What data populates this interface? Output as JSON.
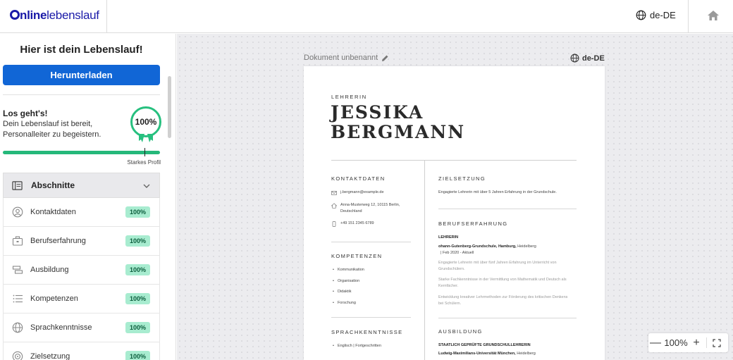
{
  "header": {
    "logo_bold": "nline",
    "logo_rest": "lebenslauf",
    "language": "de-DE",
    "icons": [
      "globe-icon",
      "home-icon"
    ]
  },
  "sidebar": {
    "title": "Hier ist dein Lebenslauf!",
    "download_label": "Herunterladen",
    "intro_title": "Los geht's!",
    "intro_text": "Dein Lebenslauf ist bereit, Personalleiter zu begeistern.",
    "badge_value": "100%",
    "progress_fraction": 1.0,
    "progress_label": "Starkes Profil",
    "sections_label": "Abschnitte",
    "items": [
      {
        "label": "Kontaktdaten",
        "value": "100%",
        "icon": "contact-icon"
      },
      {
        "label": "Berufserfahrung",
        "value": "100%",
        "icon": "briefcase-icon"
      },
      {
        "label": "Ausbildung",
        "value": "100%",
        "icon": "education-icon"
      },
      {
        "label": "Kompetenzen",
        "value": "100%",
        "icon": "list-icon"
      },
      {
        "label": "Sprachkenntnisse",
        "value": "100%",
        "icon": "globe-icon"
      },
      {
        "label": "Zielsetzung",
        "value": "100%",
        "icon": "target-icon"
      }
    ]
  },
  "document": {
    "name": "Dokument unbenannt",
    "language": "de-DE"
  },
  "resume": {
    "role": "LEHRERIN",
    "first_name": "JESSIKA",
    "last_name": "BERGMANN",
    "contact_heading": "KONTAKTDATEN",
    "email": "j.bergmann@example.de",
    "address_line1": "Anna-Musterweg 12, 10115 Berlin,",
    "address_line2": "Deutschland",
    "phone": "+49 151 2345 6789",
    "skills_heading": "KOMPETENZEN",
    "skills": [
      "Kommunikation",
      "Organisation",
      "Didaktik",
      "Forschung"
    ],
    "languages_heading": "SPRACHKENNTNISSE",
    "languages": [
      "Englisch | Fortgeschritten"
    ],
    "objective_heading": "ZIELSETZUNG",
    "objective_text": "Engagierte Lehrerin mit über 5 Jahren Erfahrung in der Grundschule.",
    "experience_heading": "BERUFSERFAHRUNG",
    "job_title": "LEHRERIN",
    "job_employer": "ohann-Gutenberg-Grundschule, Hamburg,",
    "job_city": "Heidelberg",
    "job_dates": "| Feb 2020 - Aktuell",
    "job_bullets": [
      [
        "Engagierte Lehrerin mit über fünf Jahren Erfahrung im Unterricht von",
        "Grundschülern."
      ],
      [
        "Starke Fachkenntnisse in der Vermittlung von Mathematik und Deutsch als",
        "Kernfächer."
      ],
      [
        "Entwicklung kreativer Lehrmethoden zur Förderung des kritischen Denkens",
        "bei Schülern."
      ]
    ],
    "education_heading": "AUSBILDUNG",
    "degree": "STAATLICH GEPRÜFTE GRUNDSCHULLEHRERIN",
    "school": "Ludwig-Maximilians-Universität München,",
    "school_city": "Heidelberg"
  },
  "zoom": {
    "minus": "—",
    "value": "100%",
    "plus": "+"
  }
}
